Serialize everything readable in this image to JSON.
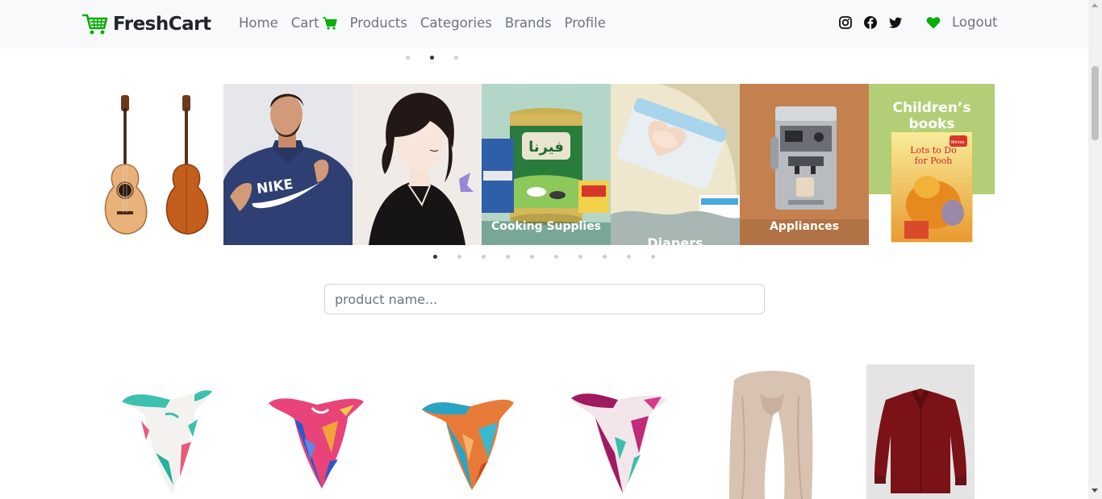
{
  "brand": {
    "name": "FreshCart",
    "icon": "cart-logo-icon",
    "color": "#0aad0a"
  },
  "nav": {
    "links": [
      {
        "label": "Home"
      },
      {
        "label": "Cart",
        "icon": "cart-icon"
      },
      {
        "label": "Products"
      },
      {
        "label": "Categories"
      },
      {
        "label": "Brands"
      },
      {
        "label": "Profile"
      }
    ],
    "social": [
      "instagram-icon",
      "facebook-icon",
      "twitter-icon"
    ],
    "wishlist_icon": "heart-icon",
    "logout_label": "Logout"
  },
  "main_slider": {
    "dot_count": 3,
    "active_index": 1
  },
  "category_slider": {
    "slides": [
      {
        "name": "guitars-slide",
        "label": ""
      },
      {
        "name": "men-fashion-slide",
        "label": ""
      },
      {
        "name": "women-fashion-slide",
        "label": ""
      },
      {
        "name": "cooking-supplies-slide",
        "label": "Cooking Supplies"
      },
      {
        "name": "diapers-slide",
        "label": "Diapers"
      },
      {
        "name": "appliances-slide",
        "label": "Appliances"
      },
      {
        "name": "childrens-books-slide",
        "label": "Children’s books"
      }
    ],
    "book_title": "Lots to Do for Pooh",
    "dot_count": 10,
    "active_index": 0
  },
  "search": {
    "placeholder": "product name...",
    "value": ""
  },
  "products": [
    {
      "name": "scarf-mint"
    },
    {
      "name": "scarf-pink-blue"
    },
    {
      "name": "scarf-orange-teal"
    },
    {
      "name": "scarf-magenta"
    },
    {
      "name": "scarf-beige"
    },
    {
      "name": "shirt-burgundy"
    }
  ]
}
